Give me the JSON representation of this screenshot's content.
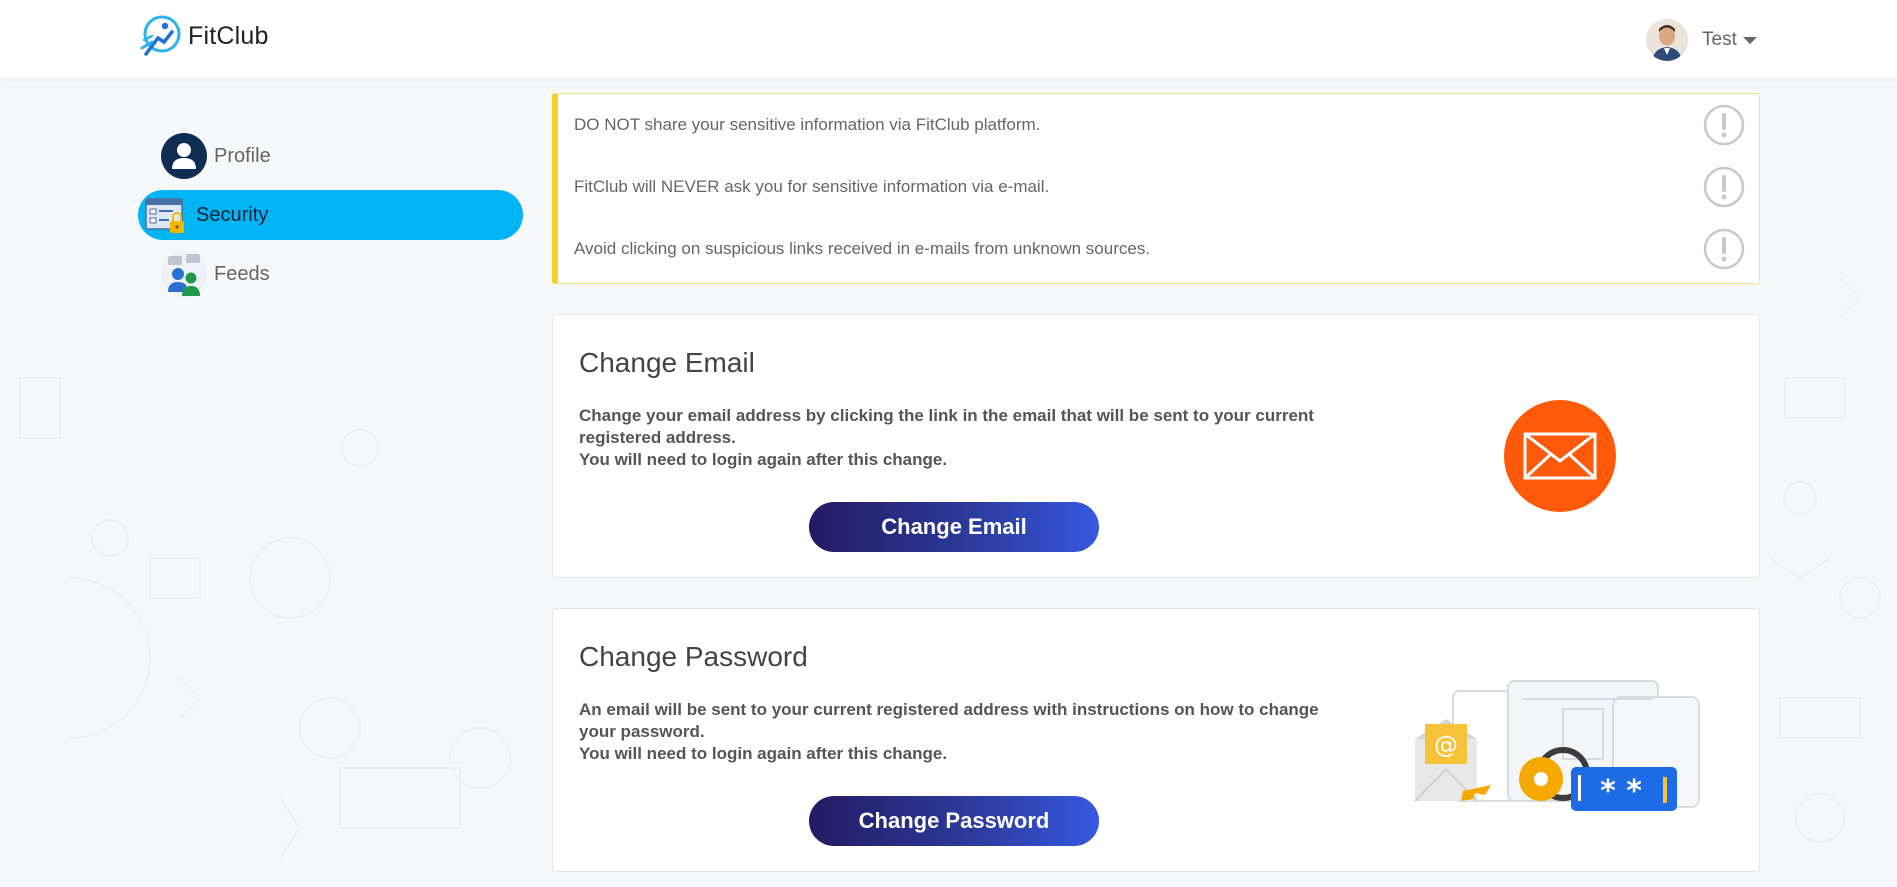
{
  "app": {
    "name": "FitClub"
  },
  "user": {
    "name": "Test"
  },
  "sidebar": {
    "items": [
      {
        "label": "Profile",
        "icon": "profile-icon",
        "active": false
      },
      {
        "label": "Security",
        "icon": "security-icon",
        "active": true
      },
      {
        "label": "Feeds",
        "icon": "feeds-icon",
        "active": false
      }
    ]
  },
  "alerts": [
    "DO NOT share your sensitive information via FitClub platform.",
    "FitClub will NEVER ask you for sensitive information via e-mail.",
    "Avoid clicking on suspicious links received in e-mails from unknown sources."
  ],
  "change_email": {
    "title": "Change Email",
    "desc_line1": "Change your email address by clicking the link in the email that will be sent to your current registered address.",
    "desc_line2": "You will need to login again after this change.",
    "button": "Change Email"
  },
  "change_password": {
    "title": "Change Password",
    "desc_line1": "An email will be sent to your current registered address with instructions on how to change your password.",
    "desc_line2": "You will need to login again after this change.",
    "button": "Change Password"
  },
  "colors": {
    "active_nav": "#00b4f5",
    "alert_accent": "#f5cf2b",
    "email_icon_bg": "#ff5a0a",
    "button_start": "#231a63",
    "button_end": "#3658e0"
  }
}
